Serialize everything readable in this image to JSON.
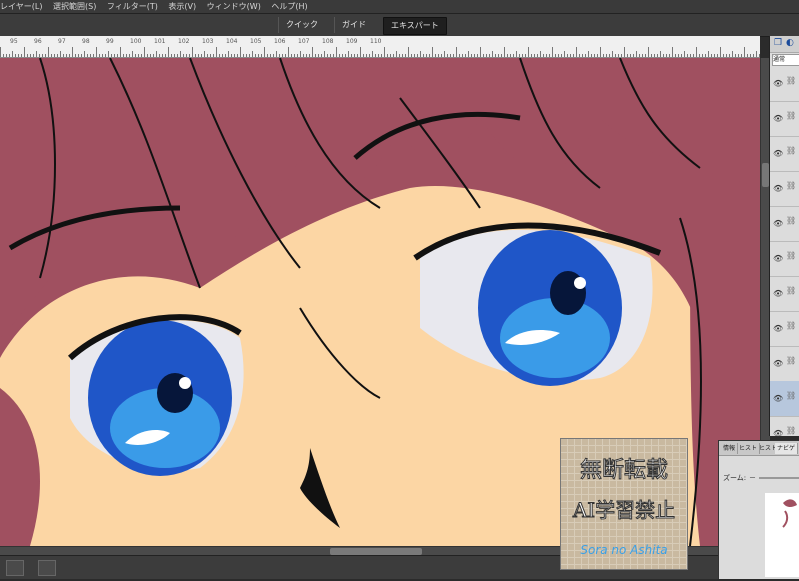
{
  "menu": {
    "items": [
      "レイヤー(L)",
      "選択範囲(S)",
      "フィルター(T)",
      "表示(V)",
      "ウィンドウ(W)",
      "ヘルプ(H)"
    ]
  },
  "modes": {
    "quick": "クイック",
    "guided": "ガイド",
    "expert": "エキスパート"
  },
  "ruler": {
    "labels": [
      "95",
      "96",
      "97",
      "98",
      "99",
      "100",
      "101",
      "102",
      "103",
      "104",
      "105",
      "106",
      "107",
      "108",
      "109",
      "110"
    ]
  },
  "layers_panel": {
    "blend_mode": "通常",
    "layer_count": 11,
    "selected_index": 9
  },
  "navigator": {
    "tabs": [
      "情報",
      "ヒスト",
      "ヒスト",
      "ナビゲ"
    ],
    "zoom_label": "ズーム:",
    "zoom_minus": "－"
  },
  "watermark": {
    "line1": "無断転載",
    "line2": "AI学習禁止",
    "signature": "Sora no Ashita"
  },
  "colors": {
    "hair": "#a05060",
    "skin": "#fcd6a4",
    "eye_blue": "#1f56c8",
    "line": "#111111"
  }
}
